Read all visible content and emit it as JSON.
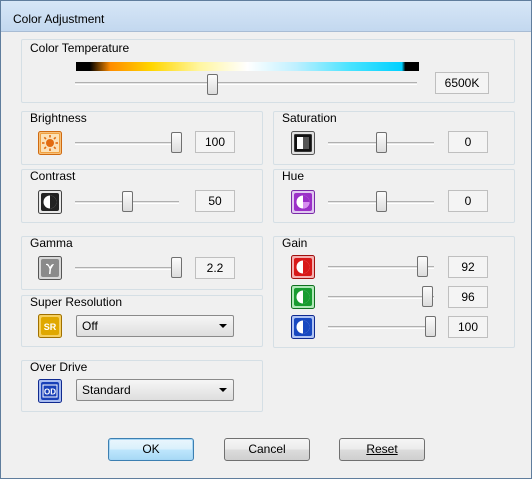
{
  "window": {
    "title": "Color Adjustment"
  },
  "color_temperature": {
    "label": "Color Temperature",
    "value": "6500K",
    "level": 0.4
  },
  "brightness": {
    "label": "Brightness",
    "value": "100",
    "level": 1.0,
    "icon": "brightness-icon"
  },
  "saturation": {
    "label": "Saturation",
    "value": "0",
    "level": 0.5,
    "icon": "saturation-icon"
  },
  "contrast": {
    "label": "Contrast",
    "value": "50",
    "level": 0.5,
    "icon": "contrast-icon"
  },
  "hue": {
    "label": "Hue",
    "value": "0",
    "level": 0.5,
    "icon": "hue-icon"
  },
  "gamma": {
    "label": "Gamma",
    "value": "2.2",
    "level": 1.0,
    "icon": "gamma-icon"
  },
  "gain": {
    "label": "Gain",
    "red": {
      "value": "92",
      "level": 0.92,
      "color": "#d81818"
    },
    "green": {
      "value": "96",
      "level": 0.96,
      "color": "#189c30"
    },
    "blue": {
      "value": "100",
      "level": 1.0,
      "color": "#1848c0"
    }
  },
  "super_resolution": {
    "label": "Super Resolution",
    "selected": "Off",
    "icon_text": "SR"
  },
  "over_drive": {
    "label": "Over Drive",
    "selected": "Standard",
    "icon_text": "OD"
  },
  "buttons": {
    "ok": "OK",
    "cancel": "Cancel",
    "reset": "Reset"
  },
  "colors": {
    "dialog_bg": "#f0f0f0",
    "default_button_border": "#3c7fb1"
  }
}
